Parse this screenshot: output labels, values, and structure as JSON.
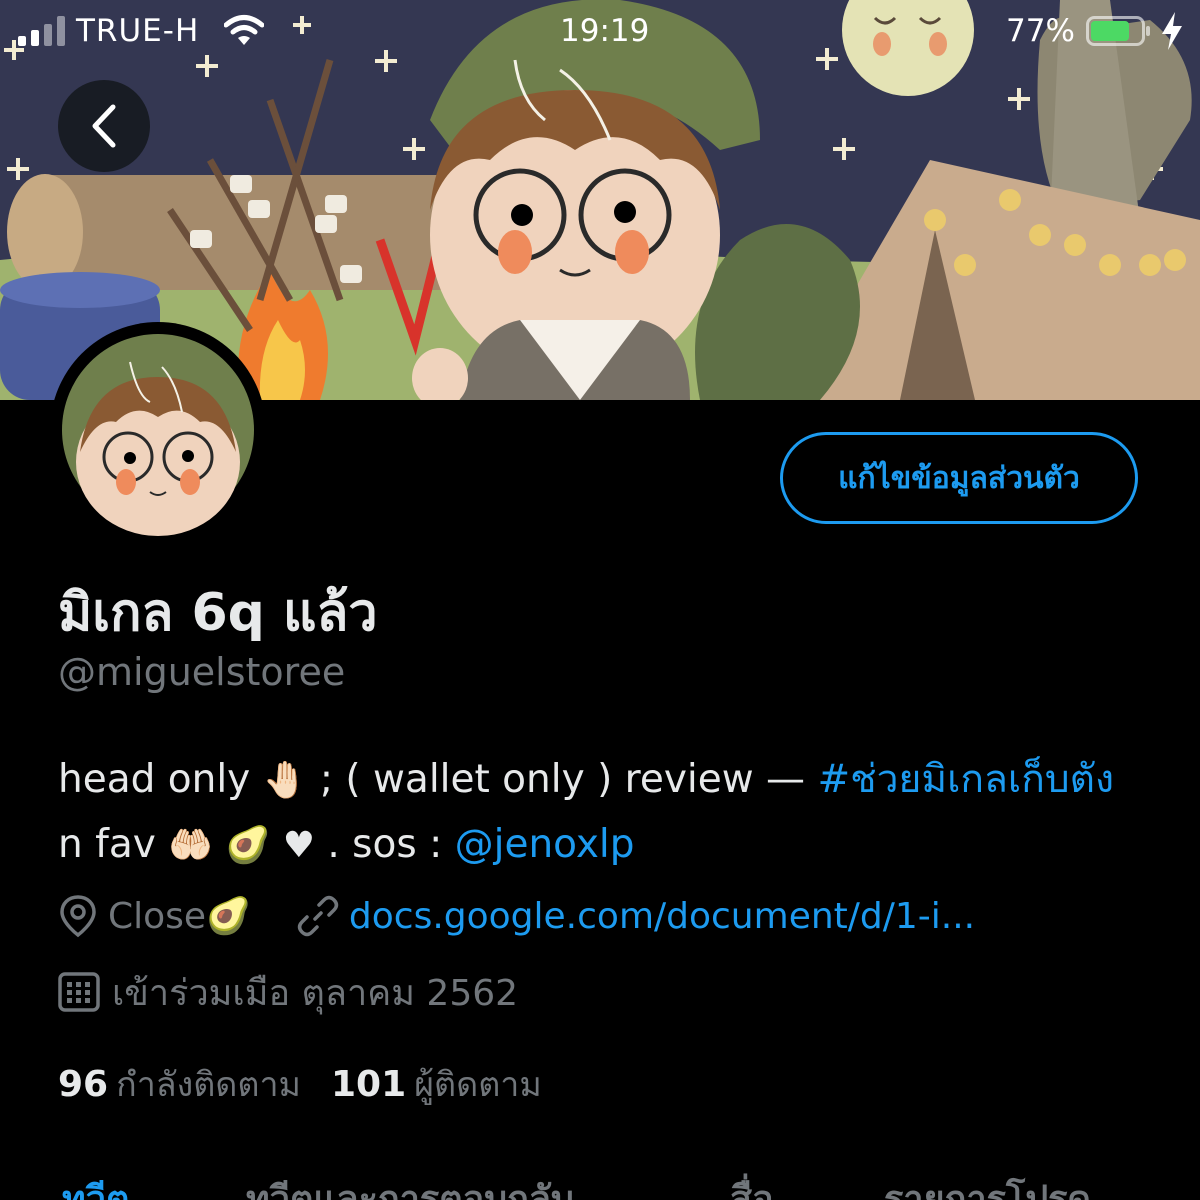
{
  "status_bar": {
    "carrier": "TRUE-H",
    "time": "19:19",
    "battery_percent": "77%",
    "battery_level": 0.77,
    "charging": true
  },
  "profile": {
    "display_name": "มิเกล 6q แล้ว",
    "handle": "@miguelstoree",
    "edit_button_label": "แก้ไขข้อมูลส่วนตัว",
    "bio": {
      "part1": "head only ",
      "emoji1": "🤚🏻",
      "part2": " ; ( wallet only ) review — ",
      "hashtag": "#ช่วยมิเกลเก็บตัง",
      "part3": " n fav ",
      "emoji2": "🤲🏻",
      "emoji3": "🥑",
      "emoji4": "♥",
      "part4": " . sos : ",
      "mention": "@jenoxlp"
    },
    "location": "Close",
    "location_emoji": "🥑",
    "website": "docs.google.com/document/d/1-i...",
    "joined": "เข้าร่วมเมือ ตุลาคม 2562",
    "following_count": "96",
    "following_label": "กำลังติดตาม",
    "followers_count": "101",
    "followers_label": "ผู้ติดตาม"
  },
  "tabs": [
    {
      "label": "ทวีต",
      "active": true
    },
    {
      "label": "ทวีตและการตอบกลับ",
      "active": false
    },
    {
      "label": "สื่อ",
      "active": false
    },
    {
      "label": "รายการโปรด",
      "active": false
    }
  ],
  "colors": {
    "accent": "#1d9bf0",
    "background": "#000000",
    "secondary_text": "#71767b",
    "battery": "#4cd964"
  },
  "icons": [
    "signal-icon",
    "wifi-icon",
    "battery-icon",
    "charging-bolt-icon",
    "back-arrow-icon",
    "location-pin-icon",
    "link-icon",
    "calendar-icon"
  ]
}
